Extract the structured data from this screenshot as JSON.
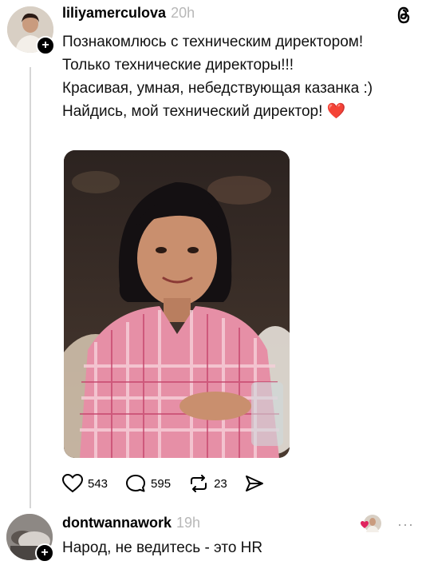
{
  "post": {
    "username": "liliyamerculova",
    "time": "20h",
    "lines": [
      "Познакомлюсь с техническим директором!",
      "Только технические директоры!!!",
      "Красивая, умная, небедствующая казанка :)",
      "Найдись, мой технический директор!"
    ],
    "heart_emoji": "❤️",
    "follow_badge": "+",
    "logo_icon": "threads-logo-icon"
  },
  "actions": {
    "likes": "543",
    "comments": "595",
    "reposts": "23"
  },
  "reply": {
    "username": "dontwannawork",
    "time": "19h",
    "text": "Народ, не ведитесь - это HR",
    "follow_badge": "+",
    "more": "···"
  },
  "colors": {
    "accent_heart": "#e0245e",
    "muted_text": "#b8b8b8",
    "thread_line": "#d6d6d6"
  }
}
